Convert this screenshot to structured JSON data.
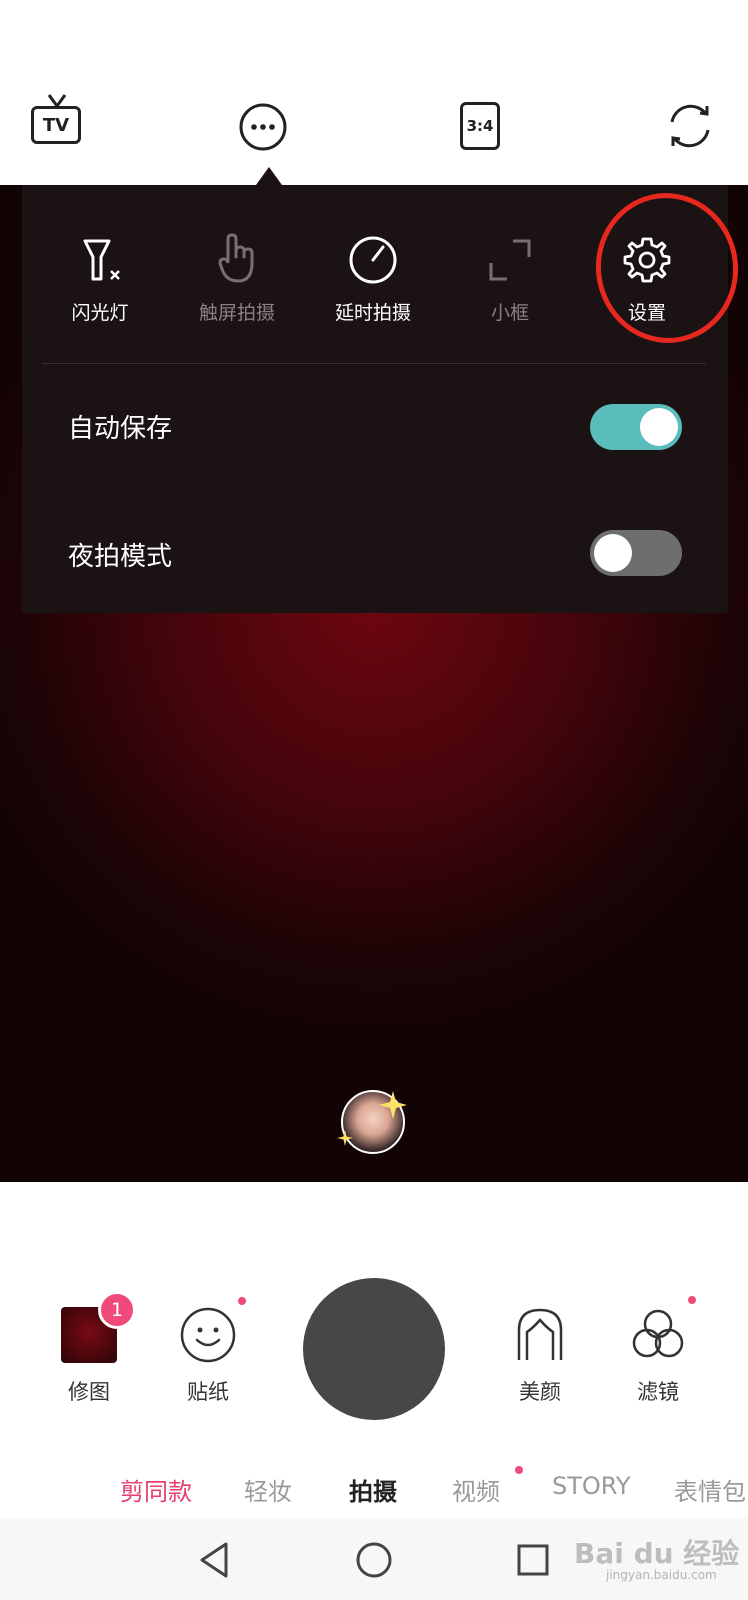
{
  "top_bar": {
    "tv_label": "TV",
    "ratio_label": "3:4",
    "icons": [
      "tv-icon",
      "more-icon",
      "aspect-ratio-icon",
      "switch-camera-icon"
    ]
  },
  "quick_settings": [
    {
      "label": "闪光灯",
      "icon": "flash-off-icon",
      "enabled": true
    },
    {
      "label": "触屏拍摄",
      "icon": "touch-shoot-icon",
      "enabled": false
    },
    {
      "label": "延时拍摄",
      "icon": "timer-icon",
      "enabled": true
    },
    {
      "label": "小框",
      "icon": "small-frame-icon",
      "enabled": false
    },
    {
      "label": "设置",
      "icon": "gear-icon",
      "enabled": true
    }
  ],
  "toggles": [
    {
      "label": "自动保存",
      "on": true
    },
    {
      "label": "夜拍模式",
      "on": false
    }
  ],
  "bottom_tools": {
    "edit_label": "修图",
    "edit_badge": "1",
    "sticker_label": "贴纸",
    "beauty_label": "美颜",
    "filter_label": "滤镜"
  },
  "modes": [
    {
      "label": "剪同款",
      "state": "highlight"
    },
    {
      "label": "轻妆",
      "state": "normal"
    },
    {
      "label": "拍摄",
      "state": "active"
    },
    {
      "label": "视频",
      "state": "normal"
    },
    {
      "label": "STORY",
      "state": "normal"
    },
    {
      "label": "表情包",
      "state": "normal"
    }
  ],
  "watermark": "Bai du 经验",
  "watermark_sub": "jingyan.baidu.com",
  "colors": {
    "toggle_on": "#5bbcbc",
    "toggle_off": "#6e6e6e",
    "accent_pink": "#e83c6e",
    "annotation_red": "#e8281e"
  }
}
